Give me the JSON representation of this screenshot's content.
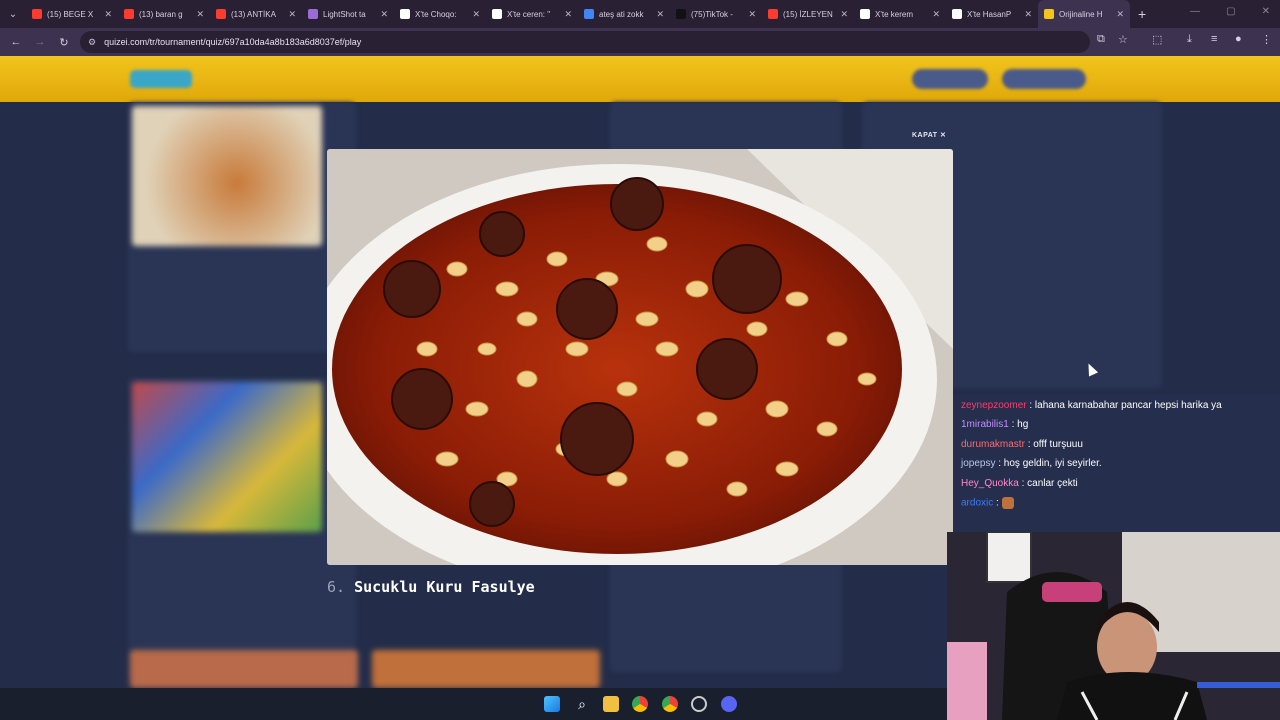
{
  "browser": {
    "tabs": [
      {
        "title": "(15) BEGE X",
        "color": "#ff3b30"
      },
      {
        "title": "(13) baran g",
        "color": "#ff3b30"
      },
      {
        "title": "(13) ANTİKA",
        "color": "#ff3b30"
      },
      {
        "title": "LightShot ta",
        "color": "#9b6bd8"
      },
      {
        "title": "X'te Choqo:",
        "color": "#ffffff"
      },
      {
        "title": "X'te ceren: \"",
        "color": "#ffffff"
      },
      {
        "title": "ateş ati zokk",
        "color": "#4285f4"
      },
      {
        "title": "(75)TikTok -",
        "color": "#111111"
      },
      {
        "title": "(15) İZLEYEN",
        "color": "#ff3b30"
      },
      {
        "title": "X'te kerem",
        "color": "#ffffff"
      },
      {
        "title": "X'te HasanP",
        "color": "#ffffff"
      },
      {
        "title": "Orijinaline H",
        "color": "#f2c41c"
      }
    ],
    "url": "quizei.com/tr/tournament/quiz/697a10da4a8b183a6d8037ef/play"
  },
  "modal": {
    "close_label": "KAPAT ✕",
    "caption_number": "6.",
    "caption_title": "Sucuklu Kuru Fasulye"
  },
  "chat": [
    {
      "user": "zeynepzoomer",
      "user_color": "#ff3b6b",
      "message": ": lahana karnabahar pancar hepsi harika ya"
    },
    {
      "user": "1mirabilis1",
      "user_color": "#c48cff",
      "message": ": hg"
    },
    {
      "user": "durumakmastr",
      "user_color": "#ff6b6b",
      "message": ": offf turşuuu"
    },
    {
      "user": "jopepsy",
      "user_color": "#b8c6e8",
      "message": ": hoş geldin, iyi seyirler."
    },
    {
      "user": "Hey_Quokka",
      "user_color": "#ff8ac8",
      "message": ": canlar çekti"
    },
    {
      "user": "ardoxic",
      "user_color": "#3b7bff",
      "message": ":"
    }
  ],
  "icons": {
    "menu": "chevron-down-icon",
    "back": "arrow-left-icon",
    "forward": "arrow-right-icon",
    "reload": "reload-icon",
    "newtab": "plus-icon"
  },
  "colors": {
    "site_header": "#f2c41c",
    "page_bg": "#222c48"
  }
}
